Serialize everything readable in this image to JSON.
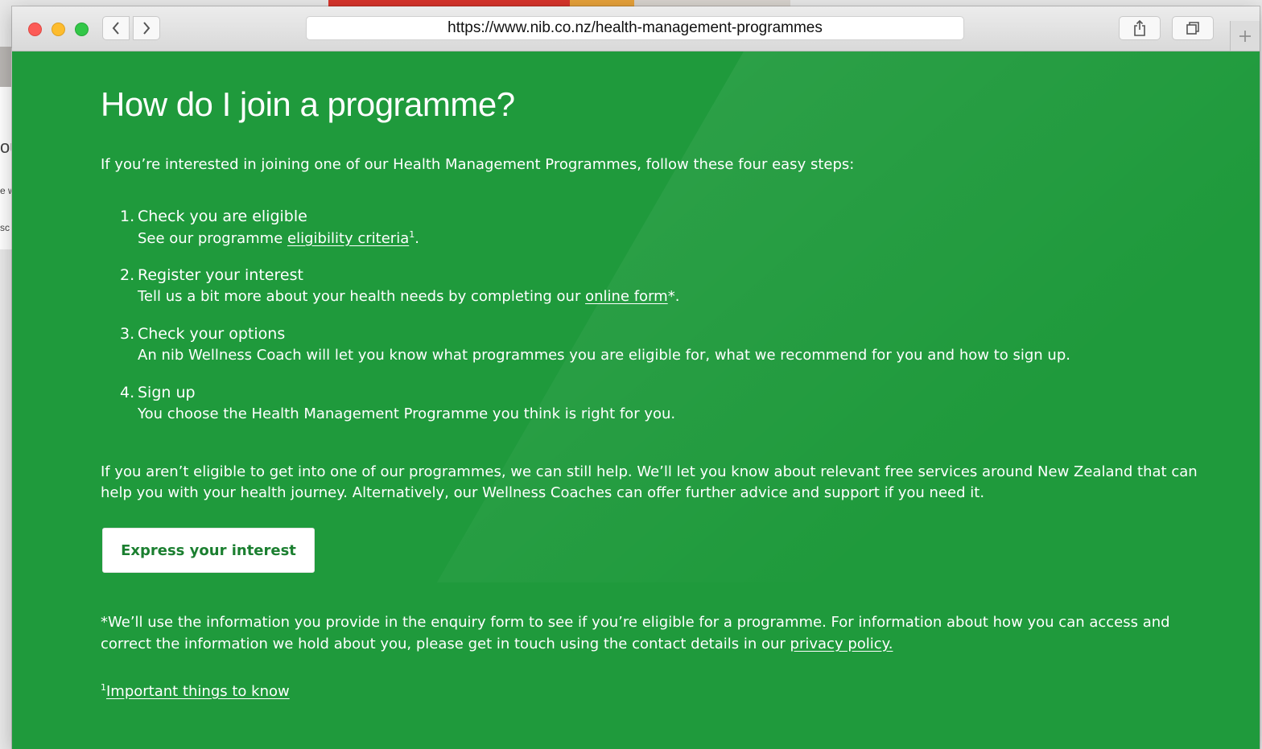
{
  "browser": {
    "url": "https://www.nib.co.nz/health-management-programmes",
    "icons": {
      "back": "chevron-left-icon",
      "forward": "chevron-right-icon",
      "share": "share-icon",
      "tabs": "tabs-icon",
      "new_tab": "plus-icon"
    }
  },
  "background_page": {
    "snippets": [
      "ou",
      "e w",
      "sc"
    ]
  },
  "page": {
    "title": "How do I join a programme?",
    "intro": "If you’re interested in joining one of our Health Management Programmes, follow these four easy steps:",
    "steps": [
      {
        "number": "1.",
        "title": "Check you are eligible",
        "desc_before": "See our programme ",
        "link": "eligibility criteria",
        "sup": "1",
        "desc_after": "."
      },
      {
        "number": "2.",
        "title": "Register your interest",
        "desc_before": "Tell us a bit more about your health needs by completing our ",
        "link": "online form",
        "desc_after": "*."
      },
      {
        "number": "3.",
        "title": "Check your options",
        "desc": "An nib Wellness Coach will let you know what programmes you are eligible for, what we recommend for you and how to sign up."
      },
      {
        "number": "4.",
        "title": "Sign up",
        "desc": "You choose the Health Management Programme you think is right for you."
      }
    ],
    "note": "If you aren’t eligible to get into one of our programmes, we can still help. We’ll let you know about relevant free services around New Zealand that can help you with your health journey. Alternatively, our Wellness Coaches can offer further advice and support if you need it.",
    "cta_label": "Express your interest",
    "disclaimer_before": "*We’ll use the information you provide in the enquiry form to see if you’re eligible for a programme. For information about how you can access and correct the information we hold about you, please get in touch using the contact details in our ",
    "disclaimer_link": "privacy policy.",
    "footnote_sup": "1",
    "footnote_link": "Important things to know"
  },
  "colors": {
    "brand_green": "#1f9a3c",
    "button_text": "#1b7f30",
    "text": "#ffffff"
  }
}
